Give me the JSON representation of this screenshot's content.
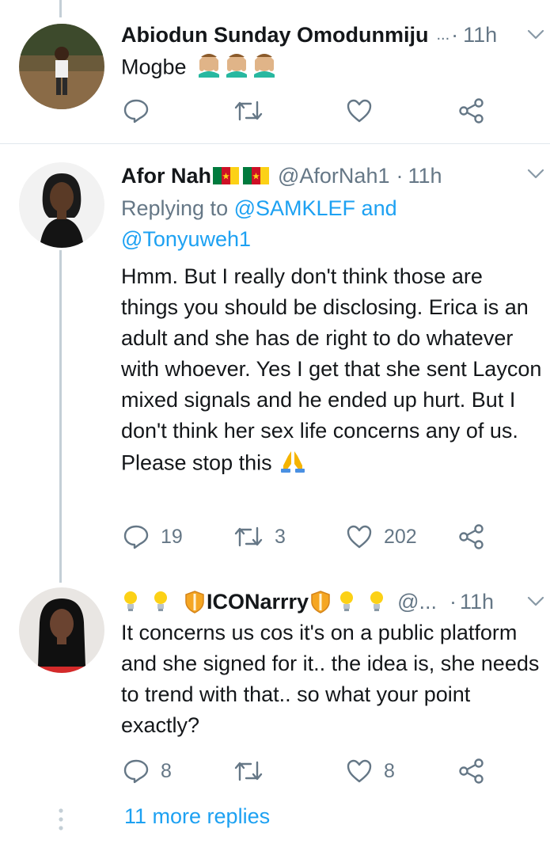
{
  "tweets": [
    {
      "name": "Abiodun Sunday Omodunmiju",
      "handle": "...",
      "sep": "·",
      "time": "11h",
      "text": "Mogbe",
      "emoji": [
        "person-facepalming",
        "person-facepalming",
        "person-facepalming"
      ],
      "replies": "",
      "retweets": "",
      "likes": ""
    },
    {
      "name": "Afor Nah",
      "handle": "@AforNah1",
      "sep": "·",
      "time": "11h",
      "replying_prefix": "Replying to",
      "replying_users": "@SAMKLEF and @Tonyuweh1",
      "text": "Hmm. But I really don't think those are things you should be disclosing. Erica is an adult and she has de right to do whatever with whoever. Yes I get that she sent Laycon mixed signals and he ended up hurt. But I don't think her sex life concerns any of us. Please stop this",
      "emoji": [
        "folded-hands"
      ],
      "flags": [
        "cameroon-flag",
        "cameroon-flag"
      ],
      "replies": "19",
      "retweets": "3",
      "likes": "202"
    },
    {
      "name": "ICONarrry",
      "handle": "@...",
      "sep": "·",
      "time": "11h",
      "text": "It concerns us cos it's on a public platform and she signed for it.. the idea is, she needs to trend with that.. so what your point exactly?",
      "replies": "8",
      "retweets": "",
      "likes": "8"
    }
  ],
  "more_replies": "11 more replies",
  "colors": {
    "accent": "#1da1f2",
    "muted": "#657786",
    "thread": "#c4cfd6"
  }
}
